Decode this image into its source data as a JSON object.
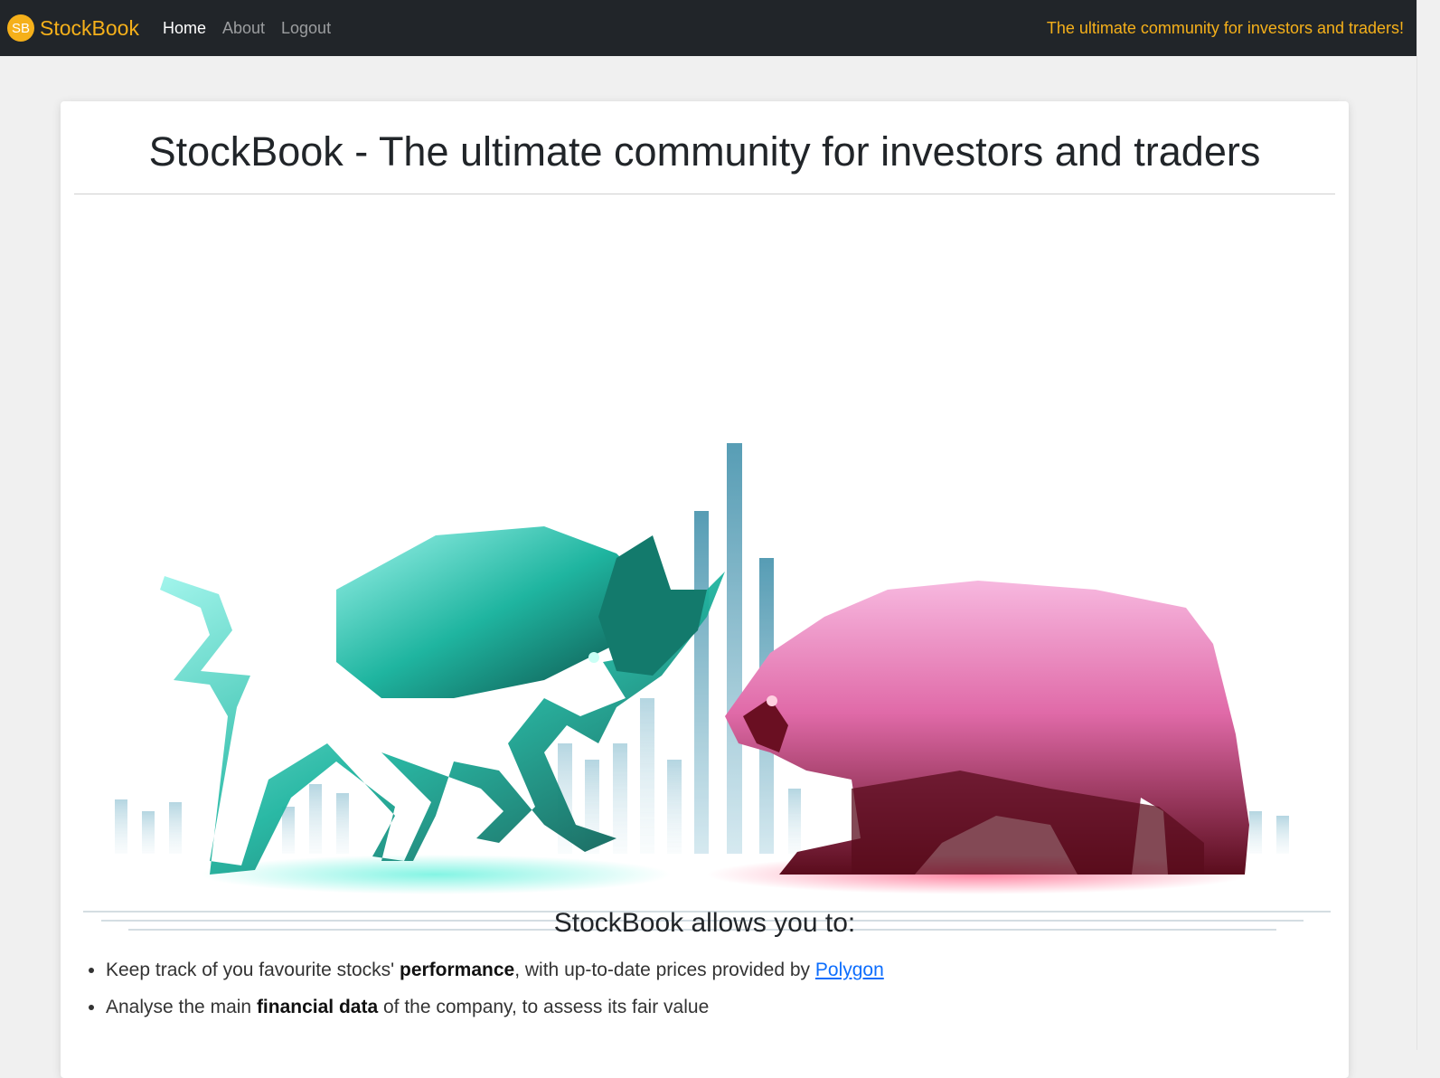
{
  "navbar": {
    "logo_text": "SB",
    "brand": "StockBook",
    "links": [
      {
        "label": "Home"
      },
      {
        "label": "About"
      },
      {
        "label": "Logout"
      }
    ],
    "tagline": "The ultimate community for investors and traders!"
  },
  "main": {
    "title": "StockBook - The ultimate community for investors and traders",
    "hero_image": "bull-vs-bear-illustration",
    "section_heading": "StockBook allows you to:",
    "features": [
      {
        "pre": "Keep track of you favourite stocks' ",
        "bold": "performance",
        "post": ", with up-to-date prices provided by ",
        "link": "Polygon"
      },
      {
        "pre": "Analyse the main ",
        "bold": "financial data",
        "post": " of the company, to assess its fair value"
      }
    ]
  },
  "colors": {
    "navbar_bg": "#212529",
    "accent": "#f5b01a",
    "bull": "#1fb5a0",
    "bear": "#c73a64",
    "link": "#0d6efd"
  }
}
